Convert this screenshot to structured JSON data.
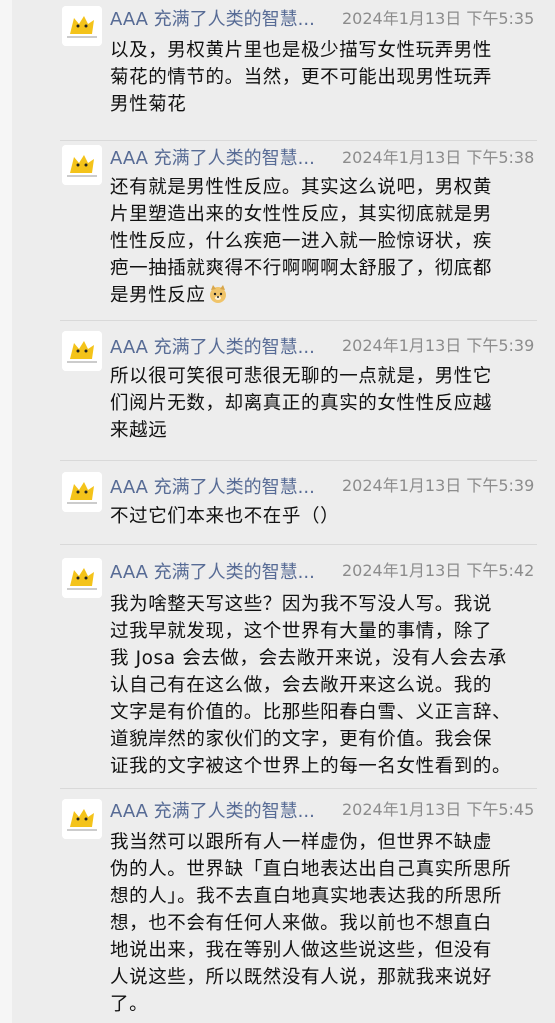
{
  "messages": [
    {
      "sender": "AAA 充满了人类的智慧...",
      "time": "2024年1月13日 下午5:35",
      "lines": [
        "以及，男权黄片里也是极少描写女性玩弄男性",
        "菊花的情节的。当然，更不可能出现男性玩弄",
        "男性菊花"
      ]
    },
    {
      "sender": "AAA 充满了人类的智慧...",
      "time": "2024年1月13日 下午5:38",
      "lines": [
        "还有就是男性性反应。其实这么说吧，男权黄",
        "片里塑造出来的女性性反应，其实彻底就是男",
        "性性反应，什么疾疤一进入就一脸惊讶状，疾",
        "疤一抽插就爽得不行啊啊啊太舒服了，彻底都",
        "是男性反应"
      ],
      "emoji": "doge-emoji"
    },
    {
      "sender": "AAA 充满了人类的智慧...",
      "time": "2024年1月13日 下午5:39",
      "lines": [
        "所以很可笑很可悲很无聊的一点就是，男性它",
        "们阅片无数，却离真正的真实的女性性反应越",
        "来越远"
      ]
    },
    {
      "sender": "AAA 充满了人类的智慧...",
      "time": "2024年1月13日 下午5:39",
      "lines": [
        "不过它们本来也不在乎（）"
      ]
    },
    {
      "sender": "AAA 充满了人类的智慧...",
      "time": "2024年1月13日 下午5:42",
      "lines": [
        "我为啥整天写这些？因为我不写没人写。我说",
        "过我早就发现，这个世界有大量的事情，除了",
        "我 Josa 会去做，会去敞开来说，没有人会去承",
        "认自己有在这么做，会去敞开来这么说。我的",
        "文字是有价值的。比那些阳春白雪、义正言辞、",
        "道貌岸然的家伙们的文字，更有价值。我会保",
        "证我的文字被这个世界上的每一名女性看到的。"
      ]
    },
    {
      "sender": "AAA 充满了人类的智慧...",
      "time": "2024年1月13日 下午5:45",
      "lines": [
        "我当然可以跟所有人一样虚伪，但世界不缺虚",
        "伪的人。世界缺「直白地表达出自己真实所思所",
        "想的人」。我不去直白地真实地表达我的所思所",
        "想，也不会有任何人来做。我以前也不想直白",
        "地说出来，我在等别人做这些说这些，但没有",
        "人说这些，所以既然没有人说，那就我来说好",
        "了。"
      ]
    }
  ],
  "colors": {
    "background": "#ededed",
    "sender": "#576b95",
    "time": "#8c8c8c",
    "text": "#111111",
    "avatar_yellow": "#f4c31a"
  }
}
